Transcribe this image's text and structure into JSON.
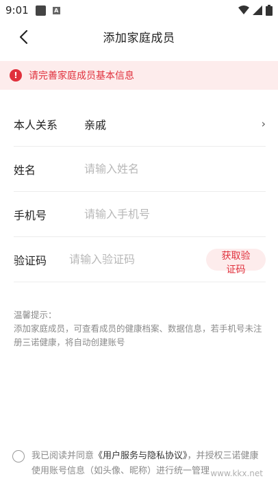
{
  "status_bar": {
    "time": "9:01"
  },
  "nav": {
    "title": "添加家庭成员"
  },
  "alert": {
    "text": "请完善家庭成员基本信息"
  },
  "form": {
    "relation": {
      "label": "本人关系",
      "value": "亲戚"
    },
    "name": {
      "label": "姓名",
      "placeholder": "请输入姓名"
    },
    "phone": {
      "label": "手机号",
      "placeholder": "请输入手机号"
    },
    "code": {
      "label": "验证码",
      "placeholder": "请输入验证码",
      "button": "获取验证码"
    }
  },
  "tips": {
    "title": "温馨提示：",
    "body": "添加家庭成员，可查看成员的健康档案、数据信息，若手机号未注册三诺健康，将自动创建账号"
  },
  "agreement": {
    "prefix": "我已阅读并同意",
    "link": "《用户服务与隐私协议》",
    "suffix": "，并授权三诺健康使用账号信息（如头像、昵称）进行统一管理"
  },
  "watermark": "www.kkx.net",
  "colors": {
    "accent": "#e0303c",
    "banner_bg": "#fdecec"
  }
}
